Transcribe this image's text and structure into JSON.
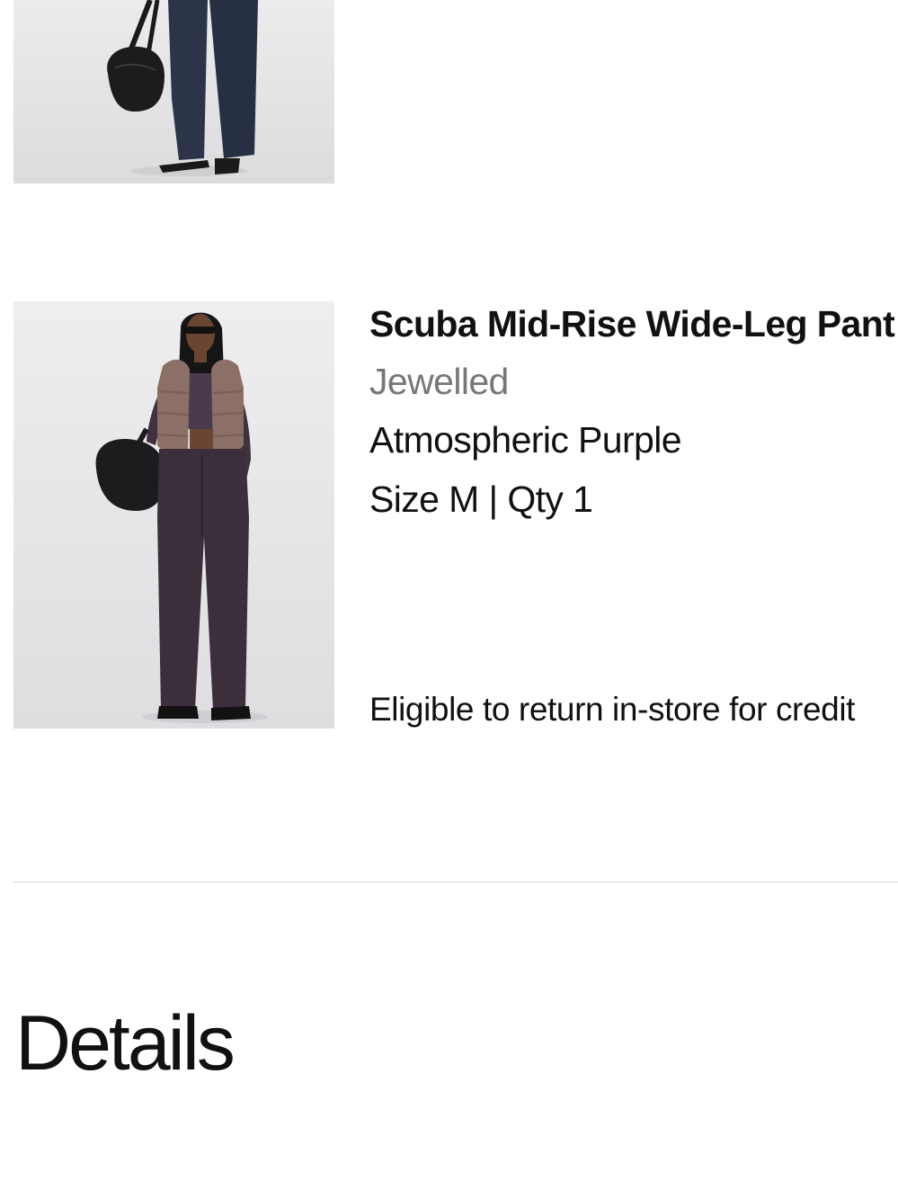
{
  "order_items": [
    {
      "image_alt": "Model wearing navy wide-leg pants holding a black bag"
    },
    {
      "image_alt": "Model wearing Scuba Mid-Rise Wide-Leg Pant in Atmospheric Purple",
      "name": "Scuba Mid-Rise Wide-Leg Pant",
      "collection": "Jewelled",
      "color": "Atmospheric Purple",
      "size_qty": "Size M | Qty 1",
      "return_note": "Eligible to return in-store for credit"
    }
  ],
  "details": {
    "heading": "Details"
  },
  "colors": {
    "text": "#111111",
    "muted": "#777777",
    "divider": "#d8d8d8",
    "photo_bg": "#e9e9ea"
  }
}
